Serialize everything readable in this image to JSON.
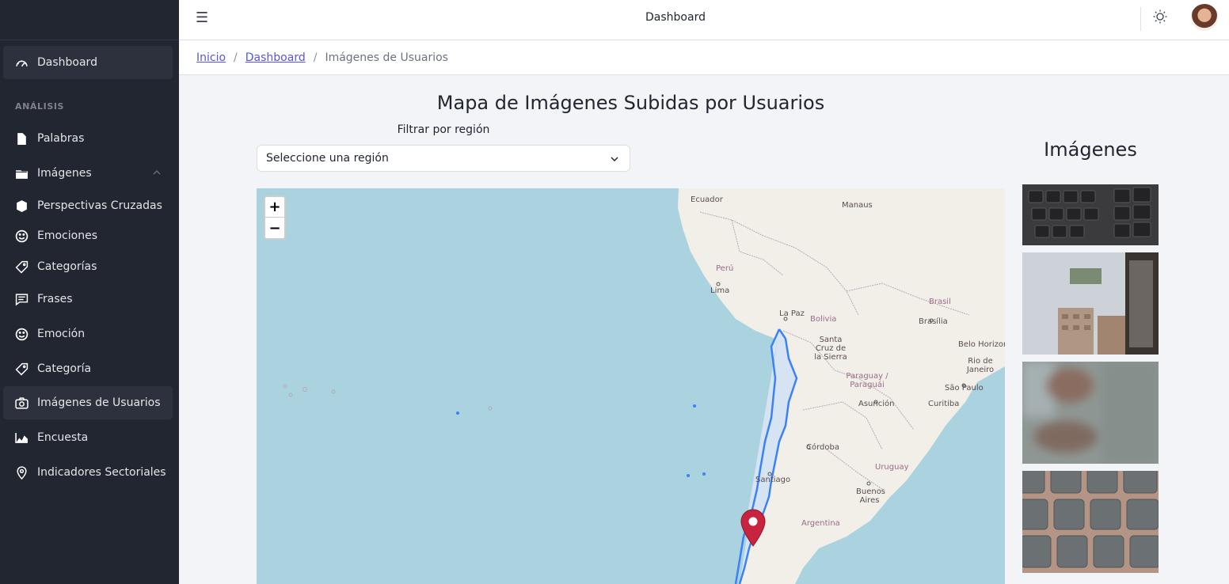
{
  "sidebar": {
    "items": [
      {
        "label": "Dashboard",
        "icon": "speedometer-icon"
      },
      {
        "label": "Palabras",
        "icon": "file-icon"
      },
      {
        "label": "Imágenes",
        "icon": "folder-icon"
      },
      {
        "label": "Perspectivas Cruzadas",
        "icon": "cube-icon"
      },
      {
        "label": "Emociones",
        "icon": "smile-icon"
      },
      {
        "label": "Categorías",
        "icon": "tag-icon"
      },
      {
        "label": "Frases",
        "icon": "chat-icon"
      },
      {
        "label": "Emoción",
        "icon": "smile-icon"
      },
      {
        "label": "Categoría",
        "icon": "tag-icon"
      },
      {
        "label": "Imágenes de Usuarios",
        "icon": "camera-icon"
      },
      {
        "label": "Encuesta",
        "icon": "chart-area-icon"
      },
      {
        "label": "Indicadores Sectoriales",
        "icon": "location-pin-icon"
      }
    ],
    "section_title": "ANÁLISIS",
    "active_item": "Imágenes de Usuarios"
  },
  "header": {
    "title": "Dashboard",
    "menu_icon": "hamburger-icon",
    "theme_icon": "sun-icon"
  },
  "breadcrumb": {
    "items": [
      "Inicio",
      "Dashboard",
      "Imágenes de Usuarios"
    ],
    "separator": "/"
  },
  "main": {
    "title": "Mapa de Imágenes Subidas por Usuarios",
    "filter_label": "Filtrar por región",
    "select_value": "Seleccione una región",
    "zoom_in": "+",
    "zoom_out": "−"
  },
  "map": {
    "labels": {
      "ecuador": "Ecuador",
      "manaus": "Manaus",
      "peru": "Perú",
      "lima": "Lima",
      "brasil": "Brasil",
      "la_paz": "La Paz",
      "bolivia": "Bolivia",
      "brasilia": "Brasília",
      "santa_cruz": "Santa Cruz de la Sierra",
      "belo_horizonte": "Belo Horizon",
      "rio": "Rio de Janeiro",
      "paraguay": "Paraguay / Paraguái",
      "sao_paulo": "São Paulo",
      "asuncion": "Asunción",
      "curitiba": "Curitiba",
      "cordoba": "Córdoba",
      "uruguay": "Uruguay",
      "santiago": "Santiago",
      "buenos_aires": "Buenos Aires",
      "argentina": "Argentina"
    }
  },
  "images_panel": {
    "title": "Imágenes",
    "thumbnails": [
      "keyboard-photo",
      "buildings-photo",
      "blurry-photo",
      "keyboard-closeup-photo"
    ]
  },
  "colors": {
    "sidebar_bg": "#212631",
    "accent_link": "#5856d6",
    "water": "#aad3df",
    "land": "#f2efe9",
    "region_outline": "#3b82f6",
    "marker": "#c8233f"
  }
}
